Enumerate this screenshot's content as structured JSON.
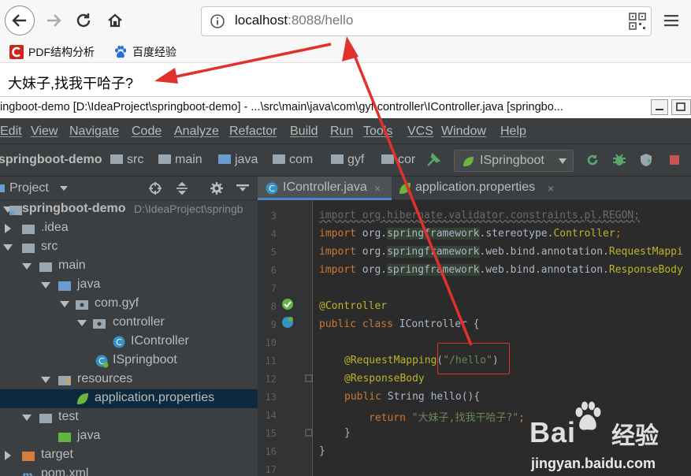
{
  "browser": {
    "url_host": "localhost",
    "url_rest": ":8088/hello",
    "bookmarks": [
      {
        "label": "PDF结构分析",
        "icon": "pdf-c-icon"
      },
      {
        "label": "百度经验",
        "icon": "baidu-paw-icon"
      }
    ]
  },
  "page": {
    "response_text": "大妹子,找我干哈子?"
  },
  "ide": {
    "title": "ingboot-demo [D:\\IdeaProject\\springboot-demo] - ...\\src\\main\\java\\com\\gyf\\controller\\IController.java [springbo...",
    "menu": [
      "Edit",
      "View",
      "Navigate",
      "Code",
      "Analyze",
      "Refactor",
      "Build",
      "Run",
      "Tools",
      "VCS",
      "Window",
      "Help"
    ],
    "breadcrumbs": [
      "springboot-demo",
      "src",
      "main",
      "java",
      "com",
      "gyf",
      "cor"
    ],
    "run_config": "ISpringboot",
    "project_panel_label": "Project",
    "tree": [
      {
        "label": "springboot-demo",
        "extra": "D:\\IdeaProject\\springb",
        "bold": true
      },
      {
        "label": ".idea"
      },
      {
        "label": "src"
      },
      {
        "label": "main"
      },
      {
        "label": "java"
      },
      {
        "label": "com.gyf"
      },
      {
        "label": "controller"
      },
      {
        "label": "IController"
      },
      {
        "label": "ISpringboot"
      },
      {
        "label": "resources"
      },
      {
        "label": "application.properties"
      },
      {
        "label": "test"
      },
      {
        "label": "java"
      },
      {
        "label": "target"
      },
      {
        "label": "pom.xml"
      }
    ],
    "tabs": [
      {
        "label": "IController.java",
        "close": "×"
      },
      {
        "label": "application.properties",
        "close": "×"
      }
    ],
    "line_numbers": [
      "3",
      "4",
      "5",
      "6",
      "7",
      "8",
      "9",
      "10",
      "11",
      "12",
      "13",
      "14",
      "15",
      "16",
      "17"
    ],
    "code": {
      "l3": "import org.hibernate.validator.constraints.pl.REGON;",
      "import_kw": "import",
      "org": "org.",
      "springframework": "springframework",
      "l4_rest": ".stereotype.",
      "l4_cls": "Controller",
      "l4_end": ";",
      "l5_rest": ".web.bind.annotation.",
      "l5_cls": "RequestMappi",
      "l6_rest": ".web.bind.annotation.",
      "l6_cls": "ResponseBody",
      "l8": "@Controller",
      "l9_kw": "public class",
      "l9_rest": " IController {",
      "l11_ann": "@RequestMapping",
      "l11_open": "(",
      "l11_str": "\"/hello\"",
      "l11_close": ")",
      "l12": "@ResponseBody",
      "l13_kw": "public",
      "l13_rest": " String hello(){",
      "l14_kw": "return",
      "l14_str": " \"大妹子,找我干哈子?\"",
      "l14_end": ";",
      "l15": "}",
      "l16": "}"
    }
  },
  "watermark": {
    "brand": "Bai",
    "brand_suffix": "经验",
    "url": "jingyan.baidu.com"
  },
  "colors": {
    "arrow_red": "#e0312d",
    "ide_bg": "#3c3f41",
    "editor_bg": "#2b2b2b"
  }
}
